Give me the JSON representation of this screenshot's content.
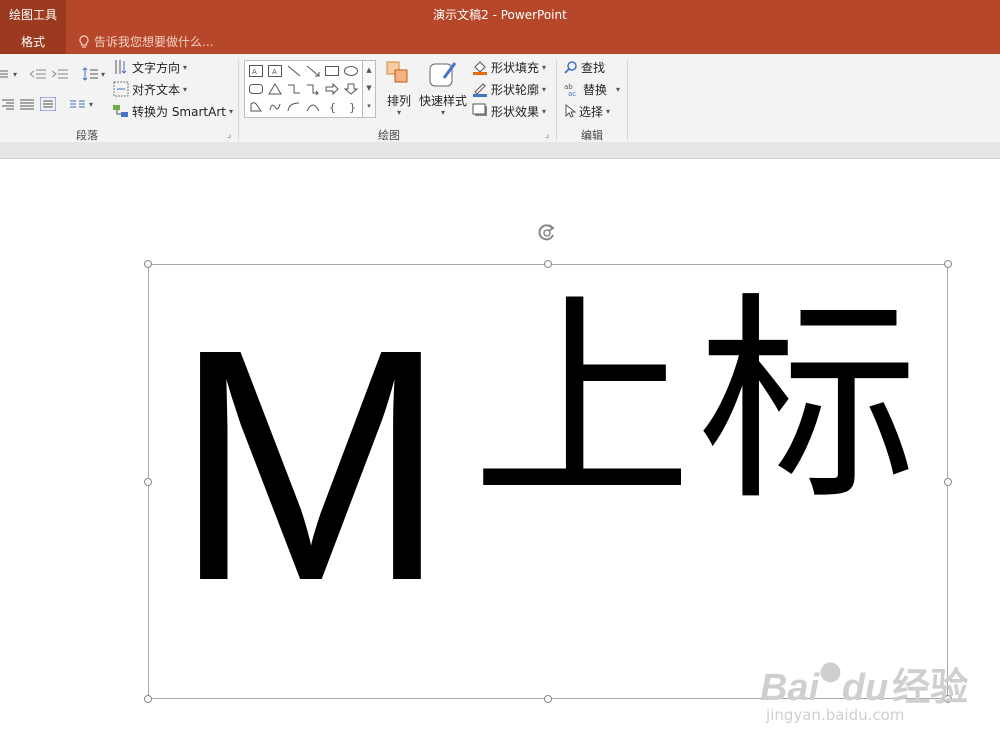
{
  "titlebar": {
    "tool_context": "绘图工具",
    "document_title": "演示文稿2 - PowerPoint",
    "active_tab": "格式",
    "tell_me_placeholder": "告诉我您想要做什么..."
  },
  "ribbon": {
    "paragraph": {
      "label": "段落",
      "text_direction": "文字方向",
      "align_text": "对齐文本",
      "convert_smartart": "转换为 SmartArt"
    },
    "drawing": {
      "label": "绘图",
      "arrange": "排列",
      "quick_styles": "快速样式",
      "shape_fill": "形状填充",
      "shape_outline": "形状轮廓",
      "shape_effects": "形状效果"
    },
    "editing": {
      "label": "编辑",
      "find": "查找",
      "replace": "替换",
      "select": "选择"
    }
  },
  "slide": {
    "main_text": "M",
    "superscript_text": "上标"
  },
  "watermark": {
    "brand": "Bai",
    "brand_suffix": "du",
    "brand_cn": "经验",
    "url": "jingyan.baidu.com"
  },
  "colors": {
    "titlebar": "#b7472a",
    "titlebar_dark": "#9c3a20",
    "ribbon_bg": "#f3f3f3"
  }
}
